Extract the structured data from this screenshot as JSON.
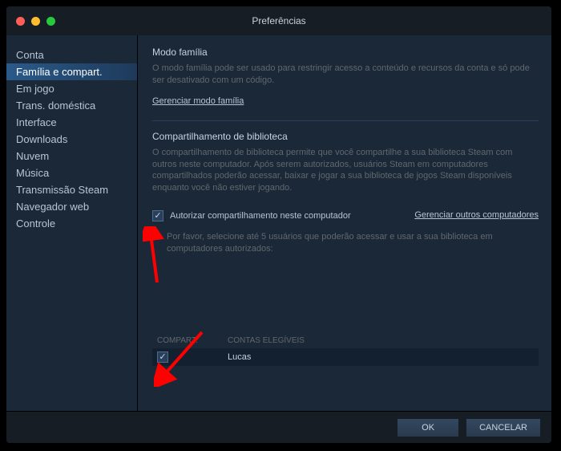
{
  "window": {
    "title": "Preferências"
  },
  "sidebar": {
    "items": [
      {
        "label": "Conta"
      },
      {
        "label": "Família e compart."
      },
      {
        "label": "Em jogo"
      },
      {
        "label": "Trans. doméstica"
      },
      {
        "label": "Interface"
      },
      {
        "label": "Downloads"
      },
      {
        "label": "Nuvem"
      },
      {
        "label": "Música"
      },
      {
        "label": "Transmissão Steam"
      },
      {
        "label": "Navegador web"
      },
      {
        "label": "Controle"
      }
    ],
    "selected_index": 1
  },
  "family_mode": {
    "title": "Modo família",
    "desc": "O modo família pode ser usado para restringir acesso a conteúdo e recursos da conta e só pode ser desativado com um código.",
    "manage_link": "Gerenciar modo família"
  },
  "library_sharing": {
    "title": "Compartilhamento de biblioteca",
    "desc": "O compartilhamento de biblioteca permite que você compartilhe a sua biblioteca Steam com outros neste computador. Após serem autorizados, usuários Steam em computadores compartilhados poderão acessar, baixar e jogar a sua biblioteca de jogos Steam disponíveis enquanto você não estiver jogando.",
    "authorize_checkbox_label": "Autorizar compartilhamento neste computador",
    "authorize_checked": true,
    "manage_other_link": "Gerenciar outros computadores",
    "select_users_desc": "Por favor, selecione até 5 usuários que poderão acessar e usar a sua biblioteca em computadores autorizados:",
    "table": {
      "header_share": "COMPART.",
      "header_accounts": "CONTAS ELEGÍVEIS",
      "rows": [
        {
          "checked": true,
          "name": "Lucas"
        }
      ]
    }
  },
  "footer": {
    "ok": "OK",
    "cancel": "CANCELAR"
  }
}
